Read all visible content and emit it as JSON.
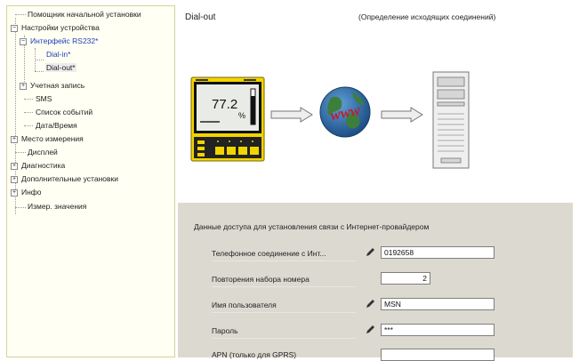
{
  "tree": {
    "items": [
      {
        "label": "Помощник начальной установки"
      },
      {
        "label": "Настройки устройства",
        "expander": "−"
      },
      {
        "label": "Интерфейс RS232*",
        "expander": "−"
      },
      {
        "label": "Dial-in*"
      },
      {
        "label": "Dial-out*"
      },
      {
        "label": "Учетная запись",
        "expander": "+"
      },
      {
        "label": "SMS"
      },
      {
        "label": "Список событий"
      },
      {
        "label": "Дата/Время"
      },
      {
        "label": "Место измерения",
        "expander": "+"
      },
      {
        "label": "Дисплей"
      },
      {
        "label": "Диагностика",
        "expander": "+"
      },
      {
        "label": "Дополнительные установки",
        "expander": "+"
      },
      {
        "label": "Инфо",
        "expander": "+"
      },
      {
        "label": "Измер. значения"
      }
    ],
    "selected_index": 4,
    "highlighted_indices": [
      2,
      3
    ]
  },
  "panel": {
    "title": "Dial-out",
    "subtitle": "(Определение исходящих соединений)"
  },
  "diagram": {
    "device_reading": "77.2",
    "device_unit": "%",
    "globe_text": "www"
  },
  "form": {
    "header": "Данные доступа для установления связи с Интернет-провайдером",
    "fields": [
      {
        "label": "Телефонное соединение с Инт...",
        "value": "0192658",
        "editable_icon": "pencil-icon"
      },
      {
        "label": "Повторения набора номера",
        "value": "2"
      },
      {
        "label": "Имя пользователя",
        "value": "MSN",
        "editable_icon": "pencil-icon"
      },
      {
        "label": "Пароль",
        "value": "***",
        "editable_icon": "pencil-icon"
      },
      {
        "label": "APN (только для GPRS)",
        "value": ""
      }
    ]
  },
  "colors": {
    "tree_bg": "#fffff4",
    "form_bg": "#dcd9d0",
    "device_yellow": "#f2d400",
    "globe_blue": "#1d4f86",
    "www_red": "#c0202a"
  }
}
